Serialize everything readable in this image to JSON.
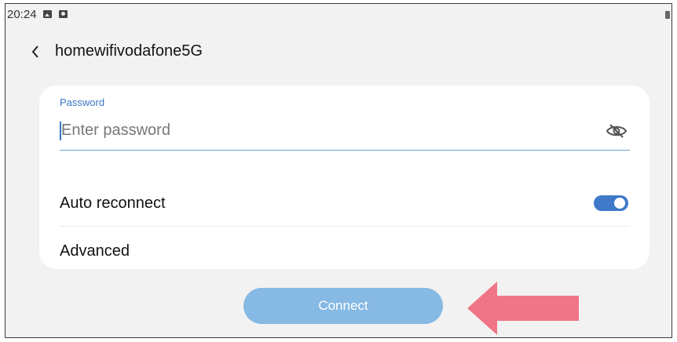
{
  "status_bar": {
    "time": "20:24",
    "icons": [
      "gallery-icon",
      "screen-record-icon",
      "battery-icon"
    ]
  },
  "header": {
    "back_icon": "chevron-left-icon",
    "title": "homewifivodafone5G"
  },
  "password": {
    "label": "Password",
    "placeholder": "Enter password",
    "value": "",
    "visibility_icon": "eye-off-icon"
  },
  "auto_reconnect": {
    "label": "Auto reconnect",
    "enabled": true
  },
  "advanced": {
    "label": "Advanced"
  },
  "connect_button": {
    "label": "Connect"
  },
  "colors": {
    "accent": "#3f79c8",
    "connect_button": "#86b9e4",
    "annotation_arrow": "#f07586",
    "background": "#f2f2f2",
    "card": "#ffffff"
  },
  "annotation": {
    "type": "arrow",
    "direction": "left",
    "target": "connect_button"
  }
}
